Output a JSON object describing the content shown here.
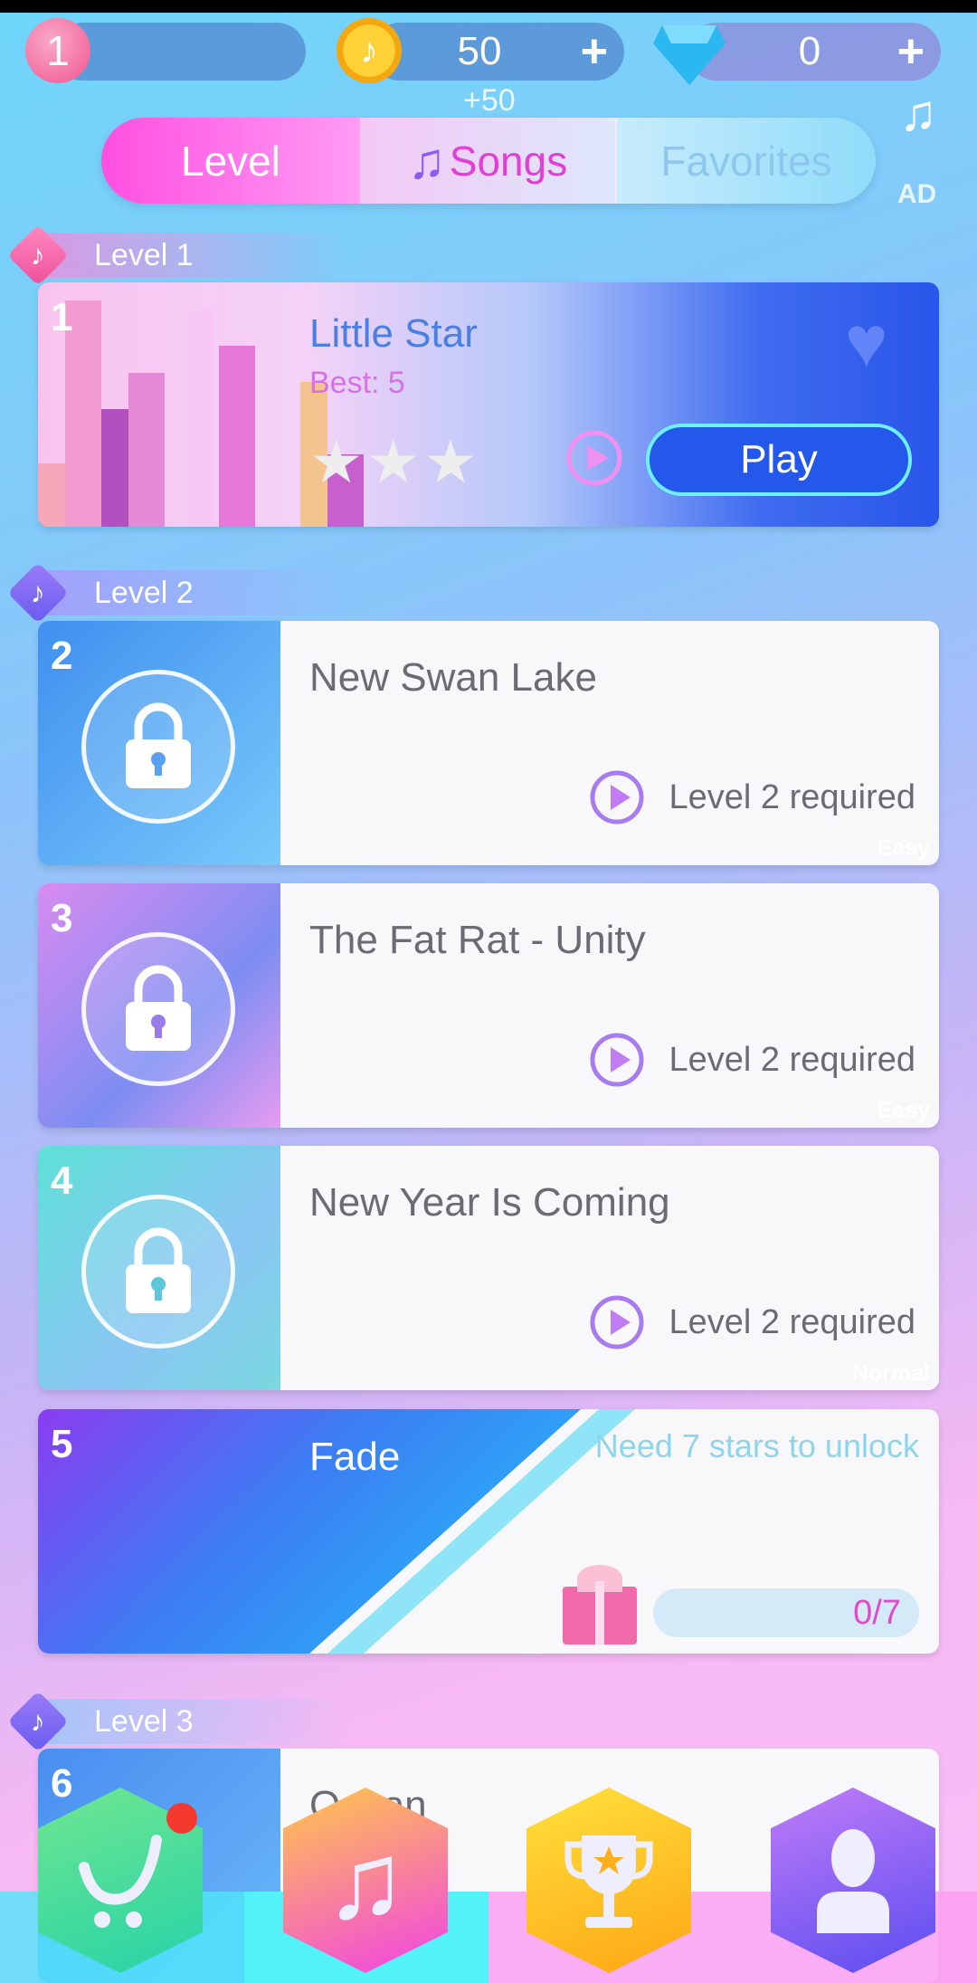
{
  "top": {
    "level": "1",
    "coins": "50",
    "coin_bonus": "+50",
    "gems": "0",
    "plus": "+",
    "ad": "AD"
  },
  "tabs": [
    {
      "label": "Level",
      "active": false
    },
    {
      "label": "Songs",
      "active": true
    },
    {
      "label": "Favorites",
      "active": false
    }
  ],
  "sections": [
    {
      "label": "Level 1"
    },
    {
      "label": "Level 2"
    },
    {
      "label": "Level 3"
    }
  ],
  "featured": {
    "number": "1",
    "title": "Little Star",
    "best": "Best: 5",
    "stars": 0,
    "play_label": "Play"
  },
  "songs": [
    {
      "number": "2",
      "title": "New Swan Lake",
      "difficulty": "Easy",
      "requirement": "Level 2 required"
    },
    {
      "number": "3",
      "title": "The Fat Rat - Unity",
      "difficulty": "Easy",
      "requirement": "Level 2 required"
    },
    {
      "number": "4",
      "title": "New Year Is Coming",
      "difficulty": "Normal",
      "requirement": "Level 2 required"
    }
  ],
  "star_song": {
    "number": "5",
    "title": "Fade",
    "unlock_text": "Need 7 stars to unlock",
    "progress": "0/7",
    "progress_value": 0
  },
  "partial_song": {
    "number": "6",
    "title": "Ocean"
  },
  "nav": [
    {
      "icon": "cart-icon",
      "color": "#3ddc9a"
    },
    {
      "icon": "music-note-icon",
      "color": "#f25fd8"
    },
    {
      "icon": "trophy-icon",
      "color": "#ffc21a"
    },
    {
      "icon": "profile-icon",
      "color": "#8a5cf5"
    }
  ]
}
